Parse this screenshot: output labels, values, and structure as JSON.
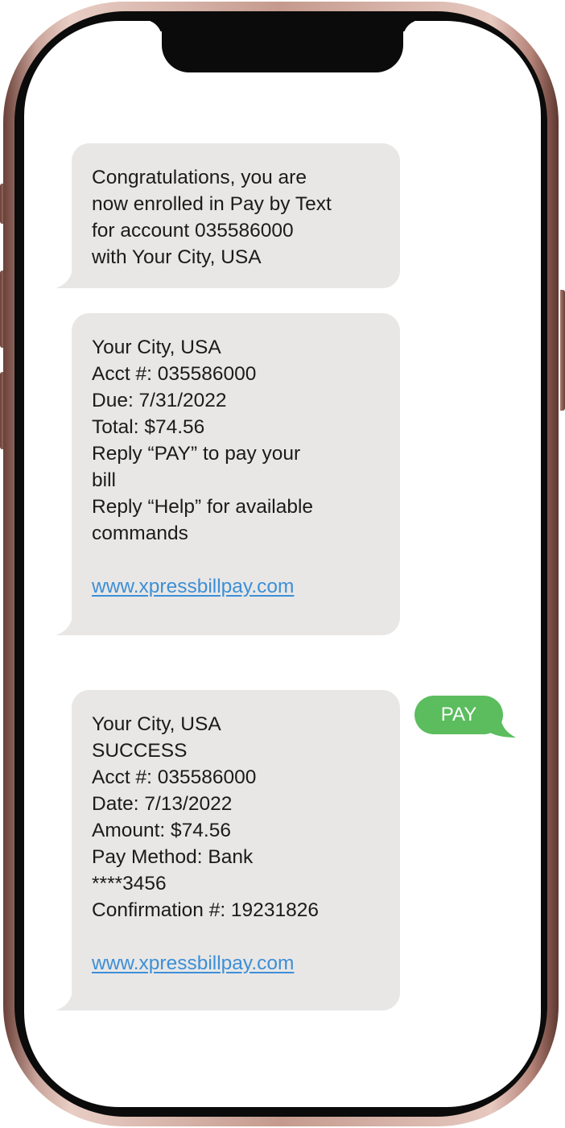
{
  "conversation": {
    "messages": [
      {
        "direction": "incoming",
        "lines": [
          "Congratulations, you are",
          "now enrolled in Pay by Text",
          "for account 035586000",
          "with Your City, USA"
        ]
      },
      {
        "direction": "incoming",
        "lines": [
          "Your City, USA",
          "Acct #: 035586000",
          "Due: 7/31/2022",
          "Total: $74.56",
          "Reply “PAY” to pay your",
          "bill",
          "Reply “Help” for available",
          "commands"
        ],
        "link": "www.xpressbillpay.com"
      },
      {
        "direction": "outgoing",
        "text": "PAY"
      },
      {
        "direction": "incoming",
        "lines": [
          "Your City, USA",
          "SUCCESS",
          "Acct #: 035586000",
          "Date: 7/13/2022",
          "Amount: $74.56",
          "Pay Method: Bank",
          "****3456",
          "Confirmation #: 19231826"
        ],
        "link": "www.xpressbillpay.com"
      }
    ]
  },
  "colors": {
    "incoming_bubble": "#e8e7e6",
    "outgoing_bubble": "#5bbd5e",
    "link": "#3d8fd6",
    "phone_frame": "#c59a8e"
  }
}
